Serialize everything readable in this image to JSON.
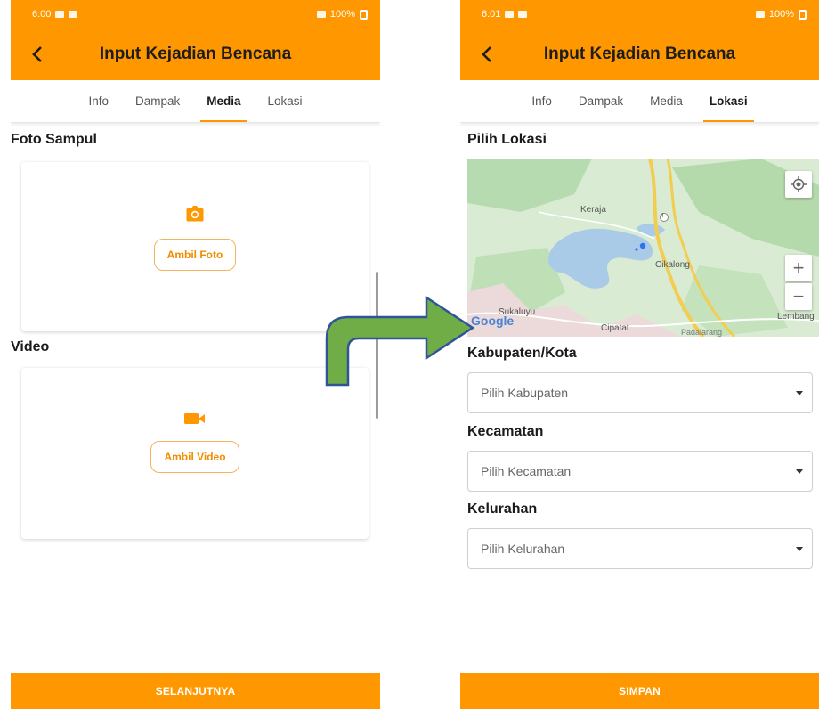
{
  "left": {
    "status": {
      "time": "6:00",
      "battery": "100%"
    },
    "header": {
      "title": "Input Kejadian Bencana"
    },
    "tabs": [
      "Info",
      "Dampak",
      "Media",
      "Lokasi"
    ],
    "active_tab": "Media",
    "photo": {
      "title": "Foto Sampul",
      "button": "Ambil Foto",
      "icon": "camera-icon"
    },
    "video": {
      "title": "Video",
      "button": "Ambil Video",
      "icon": "video-camera-icon"
    },
    "footer_button": "SELANJUTNYA"
  },
  "right": {
    "status": {
      "time": "6:01",
      "battery": "100%"
    },
    "header": {
      "title": "Input Kejadian Bencana"
    },
    "tabs": [
      "Info",
      "Dampak",
      "Media",
      "Lokasi"
    ],
    "active_tab": "Lokasi",
    "location_title": "Pilih Lokasi",
    "map": {
      "place_labels": [
        "Keraja",
        "Cikalong",
        "Sukaluyu",
        "Cipatat",
        "Padalarang",
        "Lembang"
      ],
      "road_number": "4",
      "logo": "Google"
    },
    "fields": [
      {
        "label": "Kabupaten/Kota",
        "placeholder": "Pilih Kabupaten"
      },
      {
        "label": "Kecamatan",
        "placeholder": "Pilih Kecamatan"
      },
      {
        "label": "Kelurahan",
        "placeholder": "Pilih Kelurahan"
      }
    ],
    "footer_button": "SIMPAN"
  },
  "colors": {
    "primary": "#ff9800",
    "button_outline": "#f5b25c",
    "arrow_fill": "#70ad47",
    "arrow_stroke": "#2f5597"
  }
}
